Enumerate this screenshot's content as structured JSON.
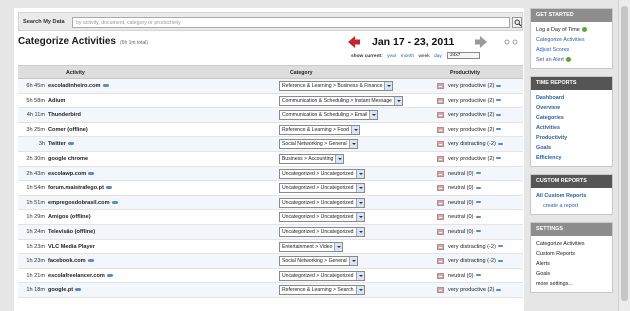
{
  "search": {
    "label": "Search My Data",
    "placeholder": "by activity, document, category or productivity"
  },
  "title": "Categorize Activities",
  "title_sub": "(6h 1m total)",
  "date_range": "Jan 17 - 23, 2011",
  "show": {
    "label": "show current:",
    "year": "year",
    "month": "month",
    "week": "week",
    "day": "day",
    "timezone": "24x7"
  },
  "columns": {
    "activity": "Activity",
    "category": "Category",
    "productivity": "Productivity"
  },
  "rows": [
    {
      "time": "6h 45m",
      "activity": "escoladinheiro.com",
      "ext": true,
      "category": "Reference & Learning > Business & Finance",
      "productivity": "very productive (2)"
    },
    {
      "time": "5h 58m",
      "activity": "Adium",
      "ext": false,
      "category": "Communication & Scheduling > Instant Message",
      "productivity": "very productive (2)"
    },
    {
      "time": "4h 11m",
      "activity": "Thunderbird",
      "ext": false,
      "category": "Communication & Scheduling > Email",
      "productivity": "very productive (2)"
    },
    {
      "time": "3h 25m",
      "activity": "Comer (offline)",
      "ext": false,
      "category": "Reference & Learning > Food",
      "productivity": "very productive (2)"
    },
    {
      "time": "3h",
      "activity": "Twitter",
      "ext": true,
      "category": "Social Networking > General",
      "productivity": "very distracting (-2)"
    },
    {
      "time": "2h 30m",
      "activity": "google chrome",
      "ext": false,
      "category": "Business > Accounting",
      "productivity": "very productive (2)"
    },
    {
      "time": "2h 43m",
      "activity": "escolawp.com",
      "ext": true,
      "category": "Uncategorized > Uncategorized",
      "productivity": "neutral (0)"
    },
    {
      "time": "1h 54m",
      "activity": "forum.maistrafego.pt",
      "ext": true,
      "category": "Uncategorized > Uncategorized",
      "productivity": "neutral (0)"
    },
    {
      "time": "1h 51m",
      "activity": "empregosdobrasil.com",
      "ext": true,
      "category": "Uncategorized > Uncategorized",
      "productivity": "neutral (0)"
    },
    {
      "time": "1h 29m",
      "activity": "Amigos (offline)",
      "ext": false,
      "category": "Uncategorized > Uncategorized",
      "productivity": "neutral (0)"
    },
    {
      "time": "1h 24m",
      "activity": "Televisão (offline)",
      "ext": false,
      "category": "Uncategorized > Uncategorized",
      "productivity": "neutral (0)"
    },
    {
      "time": "1h 23m",
      "activity": "VLC Media Player",
      "ext": false,
      "category": "Entertainment > Video",
      "productivity": "very distracting (-2)"
    },
    {
      "time": "1h 23m",
      "activity": "facebook.com",
      "ext": true,
      "category": "Social Networking > General",
      "productivity": "very distracting (-2)"
    },
    {
      "time": "1h 21m",
      "activity": "escolafreelancer.com",
      "ext": true,
      "category": "Uncategorized > Uncategorized",
      "productivity": "neutral (0)"
    },
    {
      "time": "1h 18m",
      "activity": "google.pt",
      "ext": true,
      "category": "Reference & Learning > Search",
      "productivity": "very productive (2)"
    }
  ],
  "sidebar": {
    "get_started": {
      "title": "GET STARTED",
      "items": [
        "Log a Day of Time",
        "Categorize Activities",
        "Adjust Scores",
        "Set an Alert"
      ]
    },
    "time_reports": {
      "title": "TIME REPORTS",
      "items": [
        "Dashboard",
        "Overview",
        "Categories",
        "Activities",
        "Productivity",
        "Goals",
        "Efficiency"
      ]
    },
    "custom_reports": {
      "title": "CUSTOM REPORTS",
      "items": [
        "All Custom Reports",
        "create a report"
      ]
    },
    "settings": {
      "title": "SETTINGS",
      "items": [
        "Categorize Activities",
        "Custom Reports",
        "Alerts",
        "Goals",
        "more settings..."
      ]
    }
  },
  "colors": {
    "link": "#2a62a8",
    "prev_arrow": "#c0282d",
    "header_bg": "#8d8d8d"
  }
}
